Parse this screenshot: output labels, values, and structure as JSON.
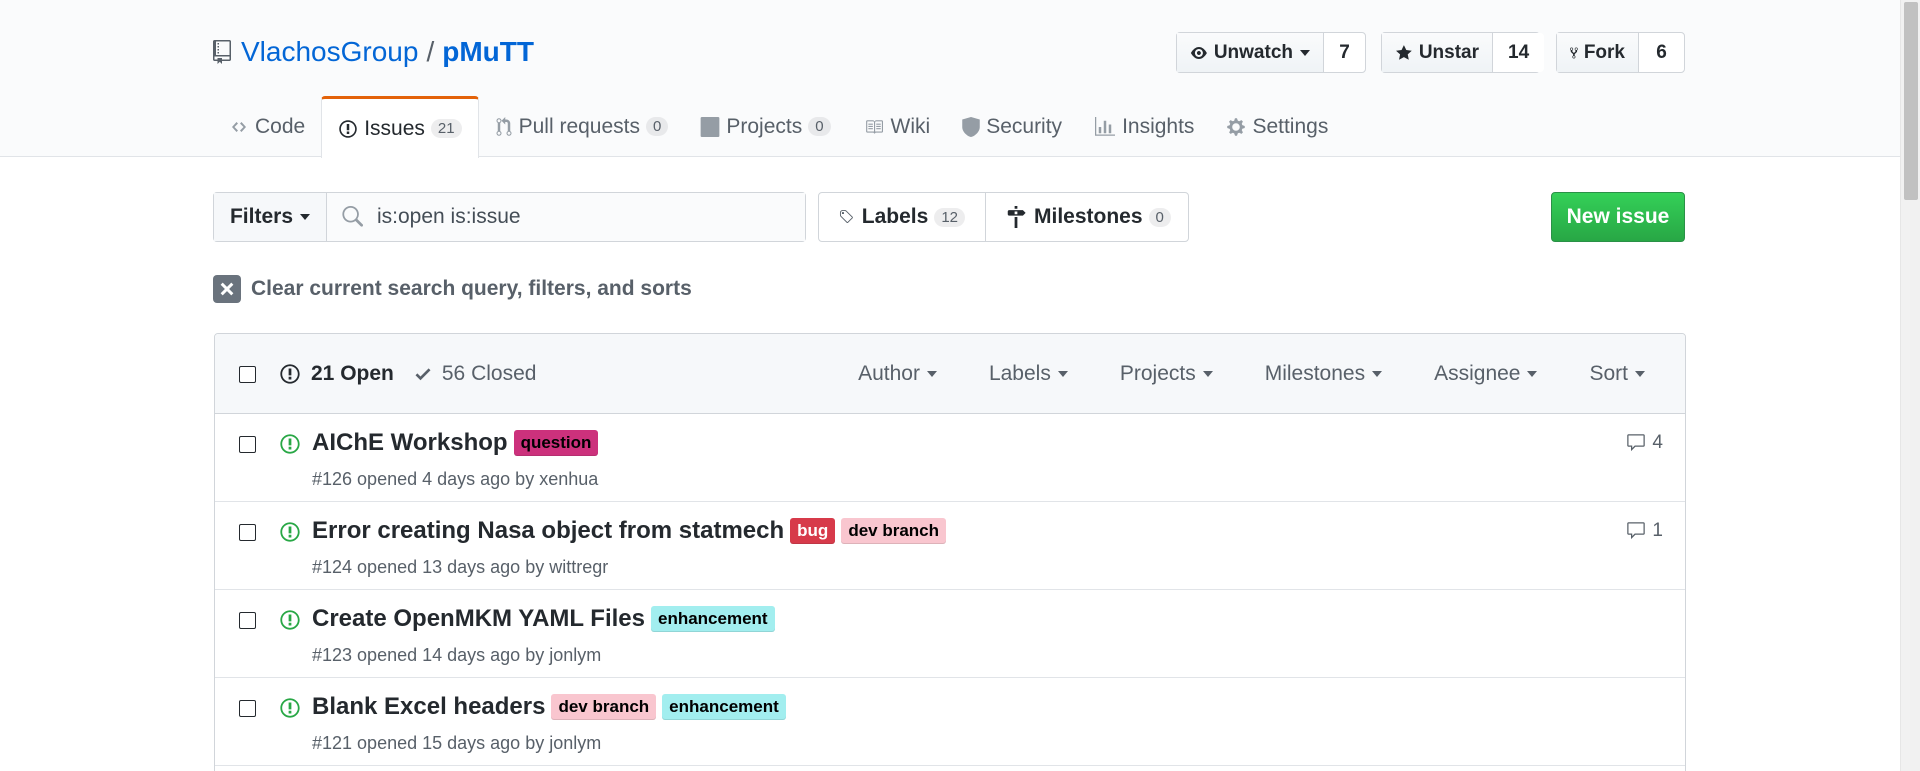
{
  "repo": {
    "owner": "VlachosGroup",
    "separator": "/",
    "name": "pMuTT"
  },
  "actions": {
    "watch": {
      "label": "Unwatch",
      "count": "7"
    },
    "star": {
      "label": "Unstar",
      "count": "14"
    },
    "fork": {
      "label": "Fork",
      "count": "6"
    }
  },
  "tabs": [
    {
      "label": "Code"
    },
    {
      "label": "Issues",
      "count": "21"
    },
    {
      "label": "Pull requests",
      "count": "0"
    },
    {
      "label": "Projects",
      "count": "0"
    },
    {
      "label": "Wiki"
    },
    {
      "label": "Security"
    },
    {
      "label": "Insights"
    },
    {
      "label": "Settings"
    }
  ],
  "filters": {
    "label": "Filters",
    "search_value": "is:open is:issue"
  },
  "labels_nav": {
    "label": "Labels",
    "count": "12"
  },
  "milestones_nav": {
    "label": "Milestones",
    "count": "0"
  },
  "new_issue": "New issue",
  "clear_text": "Clear current search query, filters, and sorts",
  "list_header": {
    "open": "21 Open",
    "closed": "56 Closed",
    "filters": [
      "Author",
      "Labels",
      "Projects",
      "Milestones",
      "Assignee",
      "Sort"
    ]
  },
  "issues": [
    {
      "title": "AIChE Workshop",
      "labels": [
        "question"
      ],
      "meta": "#126 opened 4 days ago by xenhua",
      "comments": "4"
    },
    {
      "title": "Error creating Nasa object from statmech",
      "labels": [
        "bug",
        "dev branch"
      ],
      "meta": "#124 opened 13 days ago by wittregr",
      "comments": "1"
    },
    {
      "title": "Create OpenMKM YAML Files",
      "labels": [
        "enhancement"
      ],
      "meta": "#123 opened 14 days ago by jonlym",
      "comments": ""
    },
    {
      "title": "Blank Excel headers",
      "labels": [
        "dev branch",
        "enhancement"
      ],
      "meta": "#121 opened 15 days ago by jonlym",
      "comments": ""
    }
  ],
  "label_colors": {
    "question": {
      "bg": "#cc317c",
      "fg": "#000000"
    },
    "bug": {
      "bg": "#d73a4a",
      "fg": "#ffffff"
    },
    "dev branch": {
      "bg": "#f9c6cf",
      "fg": "#000000"
    },
    "enhancement": {
      "bg": "#a2eeef",
      "fg": "#000000"
    }
  },
  "colors": {
    "accent_tab": "#e36209",
    "open_green": "#28a745",
    "link": "#0366d6"
  }
}
